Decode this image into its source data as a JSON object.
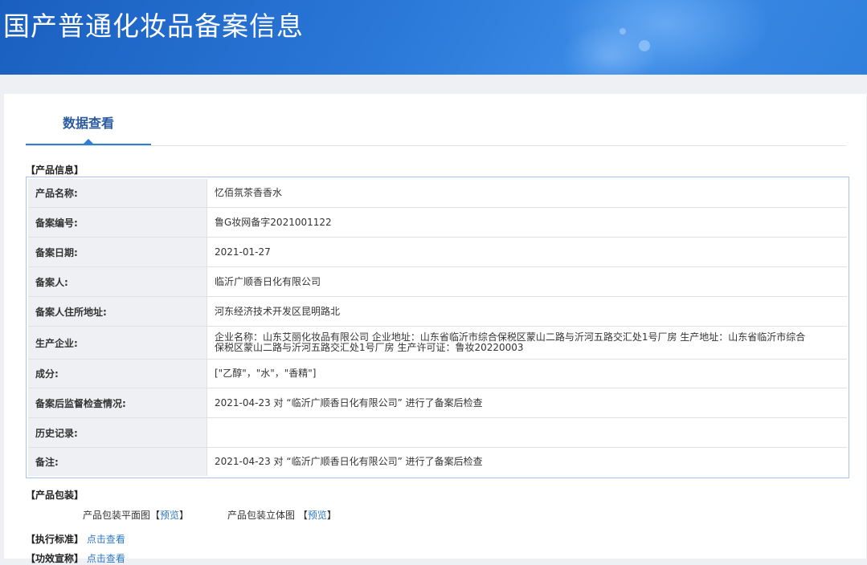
{
  "header": {
    "title": "国产普通化妆品备案信息"
  },
  "tabs": [
    {
      "label": "数据查看"
    }
  ],
  "product_info": {
    "section_title": "【产品信息】",
    "rows": [
      {
        "label": "产品名称:",
        "value": "忆佰氛茶香香水"
      },
      {
        "label": "备案编号:",
        "value": "鲁G妆网备字2021001122"
      },
      {
        "label": "备案日期:",
        "value": "2021-01-27"
      },
      {
        "label": "备案人:",
        "value": "临沂广顺香日化有限公司"
      },
      {
        "label": "备案人住所地址:",
        "value": "河东经济技术开发区昆明路北"
      },
      {
        "label": "生产企业:",
        "value": "企业名称：山东艾丽化妆品有限公司 企业地址：山东省临沂市综合保税区蒙山二路与沂河五路交汇处1号厂房 生产地址：山东省临沂市综合保税区蒙山二路与沂河五路交汇处1号厂房 生产许可证：鲁妆20220003"
      },
      {
        "label": "成分:",
        "value": "[\"乙醇\"，\"水\"，\"香精\"]"
      },
      {
        "label": "备案后监督检查情况:",
        "value": "2021-04-23 对 “临沂广顺香日化有限公司” 进行了备案后检查"
      },
      {
        "label": "历史记录:",
        "value": ""
      },
      {
        "label": "备注:",
        "value": "2021-04-23 对 “临沂广顺香日化有限公司” 进行了备案后检查"
      }
    ]
  },
  "packaging": {
    "section_title": "【产品包装】",
    "flat_label": "产品包装平面图",
    "solid_label": "产品包装立体图",
    "bracket_open": "【",
    "bracket_close": "】",
    "preview_label": "预览"
  },
  "standard": {
    "section_title": "【执行标准】",
    "link_label": "点击查看"
  },
  "efficacy": {
    "section_title": "【功效宣称】",
    "link_label": "点击查看"
  },
  "colors": {
    "banner": "#2a78d8",
    "accent": "#2f7fd2",
    "link": "#2f78c4",
    "label_bg": "#eef0f4"
  }
}
